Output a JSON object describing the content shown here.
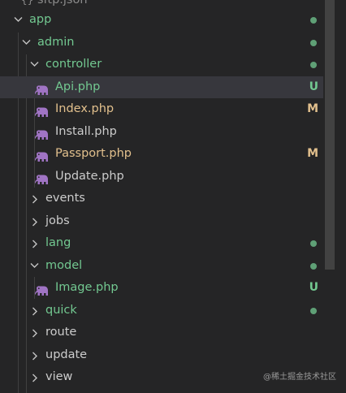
{
  "explorer": {
    "partial_top": "sftp.json",
    "scrollbar": "explorer-scrollbar",
    "items": [
      {
        "label": "app",
        "kind": "folder",
        "depth": 0,
        "expanded": true,
        "color": "#73c991",
        "status": "dot"
      },
      {
        "label": "admin",
        "kind": "folder",
        "depth": 1,
        "expanded": true,
        "color": "#73c991",
        "status": "dot"
      },
      {
        "label": "controller",
        "kind": "folder",
        "depth": 2,
        "expanded": true,
        "color": "#73c991",
        "status": "dot"
      },
      {
        "label": "Api.php",
        "kind": "file",
        "icon": "php-elephant-icon",
        "depth": 3,
        "color": "#73c991",
        "status": "U",
        "selected": true
      },
      {
        "label": "Index.php",
        "kind": "file",
        "icon": "php-elephant-icon",
        "depth": 3,
        "color": "#e2c08d",
        "status": "M"
      },
      {
        "label": "Install.php",
        "kind": "file",
        "icon": "php-elephant-icon",
        "depth": 3,
        "color": "#cccccc",
        "status": ""
      },
      {
        "label": "Passport.php",
        "kind": "file",
        "icon": "php-elephant-icon",
        "depth": 3,
        "color": "#e2c08d",
        "status": "M"
      },
      {
        "label": "Update.php",
        "kind": "file",
        "icon": "php-elephant-icon",
        "depth": 3,
        "color": "#cccccc",
        "status": ""
      },
      {
        "label": "events",
        "kind": "folder",
        "depth": 2,
        "expanded": false,
        "color": "#cccccc",
        "status": ""
      },
      {
        "label": "jobs",
        "kind": "folder",
        "depth": 2,
        "expanded": false,
        "color": "#cccccc",
        "status": ""
      },
      {
        "label": "lang",
        "kind": "folder",
        "depth": 2,
        "expanded": false,
        "color": "#73c991",
        "status": "dot"
      },
      {
        "label": "model",
        "kind": "folder",
        "depth": 2,
        "expanded": true,
        "color": "#73c991",
        "status": "dot"
      },
      {
        "label": "Image.php",
        "kind": "file",
        "icon": "php-elephant-icon",
        "depth": 3,
        "color": "#73c991",
        "status": "U"
      },
      {
        "label": "quick",
        "kind": "folder",
        "depth": 2,
        "expanded": false,
        "color": "#73c991",
        "status": "dot"
      },
      {
        "label": "route",
        "kind": "folder",
        "depth": 2,
        "expanded": false,
        "color": "#cccccc",
        "status": ""
      },
      {
        "label": "update",
        "kind": "folder",
        "depth": 2,
        "expanded": false,
        "color": "#cccccc",
        "status": ""
      },
      {
        "label": "view",
        "kind": "folder",
        "depth": 2,
        "expanded": false,
        "color": "#cccccc",
        "status": ""
      }
    ]
  },
  "watermark": "@稀土掘金技术社区",
  "colors": {
    "background": "#252526",
    "selected_row": "#37373d",
    "untracked": "#73c991",
    "modified": "#e2c08d",
    "default_text": "#cccccc",
    "php_icon": "#a074c4"
  }
}
